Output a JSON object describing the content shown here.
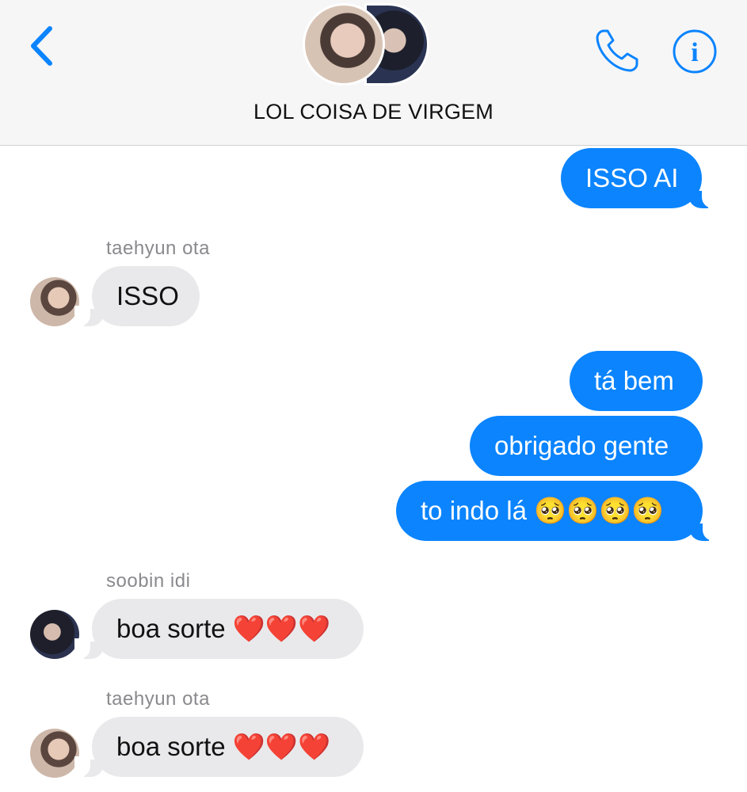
{
  "header": {
    "title": "LOL COISA DE VIRGEM",
    "back_icon": "chevron-left-icon",
    "call_icon": "phone-icon",
    "info_icon": "info-icon",
    "info_glyph": "i"
  },
  "colors": {
    "accent": "#0b84fe",
    "incoming_bubble": "#e9e9eb",
    "sender_label": "#8a8a8e",
    "header_bg": "#f6f6f7"
  },
  "messages": [
    {
      "direction": "out",
      "text": "ISSO AI"
    },
    {
      "direction": "in",
      "sender": "taehyun ota",
      "text": "ISSO"
    },
    {
      "direction": "out",
      "text": "tá bem"
    },
    {
      "direction": "out",
      "text": "obrigado gente"
    },
    {
      "direction": "out",
      "text": "to indo lá 🥺🥺🥺🥺"
    },
    {
      "direction": "in",
      "sender": "soobin idi",
      "text": "boa sorte ❤️❤️❤️"
    },
    {
      "direction": "in",
      "sender": "taehyun ota",
      "text": "boa sorte ❤️❤️❤️"
    }
  ]
}
